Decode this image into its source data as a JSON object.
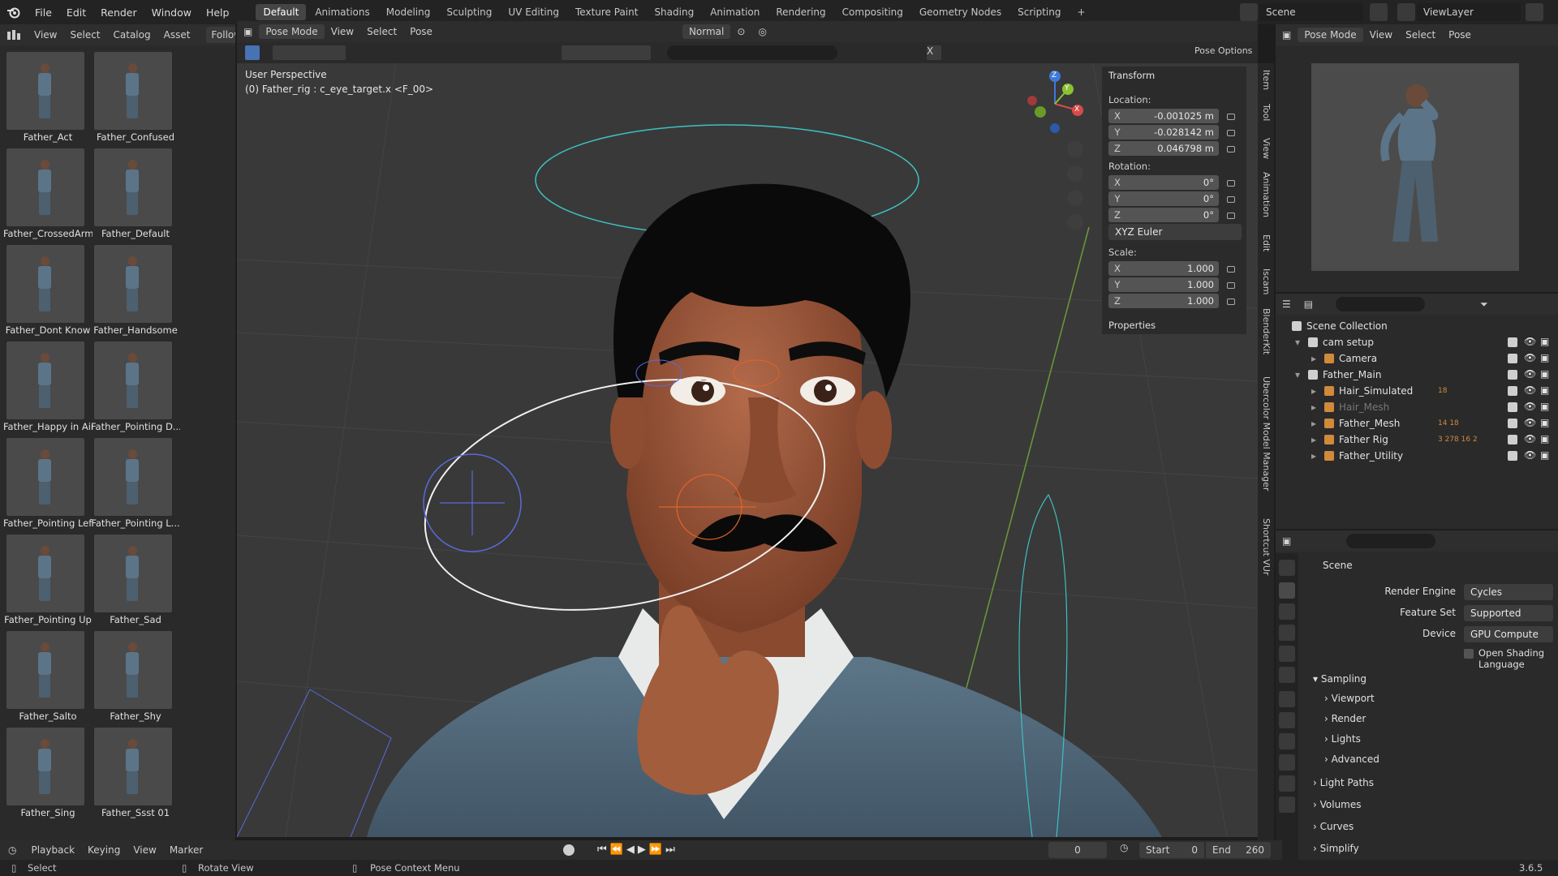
{
  "topbar": {
    "menu": [
      "File",
      "Edit",
      "Render",
      "Window",
      "Help"
    ],
    "workspaces": [
      "Default",
      "Animations",
      "Modeling",
      "Sculpting",
      "UV Editing",
      "Texture Paint",
      "Shading",
      "Animation",
      "Rendering",
      "Compositing",
      "Geometry Nodes",
      "Scripting"
    ],
    "add_tab": "+",
    "scene": "Scene",
    "view_layer": "ViewLayer"
  },
  "asset_browser": {
    "menu": [
      "View",
      "Select",
      "Catalog",
      "Asset"
    ],
    "follow": "Follow",
    "assets": [
      "Father_Act",
      "Father_Confused",
      "Father_CrossedArm",
      "Father_Default",
      "Father_Dont Know",
      "Father_Handsome",
      "Father_Happy in Air",
      "Father_Pointing D...",
      "Father_Pointing Left",
      "Father_Pointing L...",
      "Father_Pointing Up",
      "Father_Sad",
      "Father_Salto",
      "Father_Shy",
      "Father_Sing",
      "Father_Ssst 01"
    ]
  },
  "viewport": {
    "mode": "Pose Mode",
    "menu": [
      "View",
      "Select",
      "Pose"
    ],
    "orientation": "Normal",
    "perspective": "User Perspective",
    "active_bone": "(0) Father_rig : c_eye_target.x <F_00>",
    "pose_options": "Pose Options",
    "x_toggle": "X"
  },
  "transform": {
    "title": "Transform",
    "location_label": "Location:",
    "location": [
      {
        "axis": "X",
        "value": "-0.001025 m"
      },
      {
        "axis": "Y",
        "value": "-0.028142 m"
      },
      {
        "axis": "Z",
        "value": "0.046798 m"
      }
    ],
    "rotation_label": "Rotation:",
    "rotation": [
      {
        "axis": "X",
        "value": "0°"
      },
      {
        "axis": "Y",
        "value": "0°"
      },
      {
        "axis": "Z",
        "value": "0°"
      }
    ],
    "rotation_mode": "XYZ Euler",
    "scale_label": "Scale:",
    "scale": [
      {
        "axis": "X",
        "value": "1.000"
      },
      {
        "axis": "Y",
        "value": "1.000"
      },
      {
        "axis": "Z",
        "value": "1.000"
      }
    ],
    "properties": "Properties"
  },
  "side_tabs": [
    "Item",
    "Tool",
    "View",
    "Animation",
    "Edit",
    "Iscam",
    "BlenderKit",
    "Ubercolor Model Manager",
    "Shortcut VUr"
  ],
  "gizmo": {
    "x": "X",
    "y": "Y",
    "z": "Z"
  },
  "preview_header": {
    "mode": "Pose Mode",
    "menu": [
      "View",
      "Select",
      "Pose"
    ]
  },
  "outliner": {
    "rows": [
      {
        "name": "Scene Collection",
        "indent": 0
      },
      {
        "name": "cam setup",
        "indent": 1
      },
      {
        "name": "Camera",
        "indent": 2
      },
      {
        "name": "Father_Main",
        "indent": 1
      },
      {
        "name": "Hair_Simulated",
        "indent": 2,
        "badge": "18"
      },
      {
        "name": "Hair_Mesh",
        "indent": 2,
        "dim": true
      },
      {
        "name": "Father_Mesh",
        "indent": 2,
        "badge": "14 18"
      },
      {
        "name": "Father Rig",
        "indent": 2,
        "badge": "3 278 16 2"
      },
      {
        "name": "Father_Utility",
        "indent": 2
      }
    ]
  },
  "properties": {
    "scene": "Scene",
    "render_engine_label": "Render Engine",
    "render_engine": "Cycles",
    "feature_set_label": "Feature Set",
    "feature_set": "Supported",
    "device_label": "Device",
    "device": "GPU Compute",
    "osl": "Open Shading Language",
    "sampling": "Sampling",
    "sampling_items": [
      "Viewport",
      "Render",
      "Lights",
      "Advanced"
    ],
    "sections": [
      "Light Paths",
      "Volumes",
      "Curves",
      "Simplify"
    ]
  },
  "timeline": {
    "menu": [
      "Playback",
      "Keying",
      "View",
      "Marker"
    ],
    "current_frame": "0",
    "start_label": "Start",
    "start": "0",
    "end_label": "End",
    "end": "260"
  },
  "statusbar": {
    "select": "Select",
    "rotate": "Rotate View",
    "context": "Pose Context Menu",
    "version": "3.6.5"
  },
  "colors": {
    "accent": "#4772b3",
    "selected_bone": "#f0f0f0",
    "ik_orange": "#e0642a",
    "blue_bone": "#5a6ad8"
  }
}
